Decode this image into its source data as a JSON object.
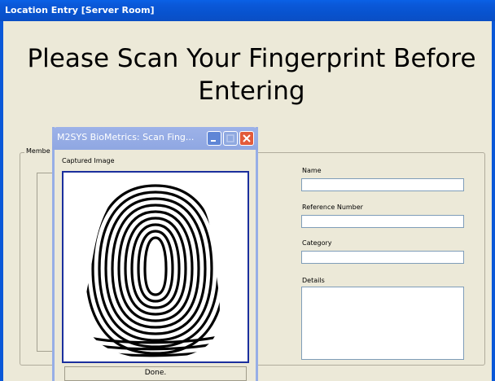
{
  "window": {
    "title": "Location Entry [Server Room]"
  },
  "heading": "Please Scan Your Fingerprint Before Entering",
  "member_group": {
    "legend": "Membe",
    "fields": [
      {
        "label": "Name",
        "value": ""
      },
      {
        "label": "Reference Number",
        "value": ""
      },
      {
        "label": "Category",
        "value": ""
      },
      {
        "label": "Details",
        "value": ""
      }
    ]
  },
  "dialog": {
    "title": "M2SYS BioMetrics: Scan Fing...",
    "captured_label": "Captured Image",
    "status": "Done.",
    "buttons": {
      "minimize": "minimize-icon",
      "maximize": "maximize-icon",
      "close": "close-icon"
    },
    "image_description": "fingerprint-image"
  },
  "colors": {
    "titlebar": "#0a58d8",
    "dialog_titlebar": "#97aee6",
    "close_button": "#e25a3a",
    "scan_border": "#1b2f9d",
    "window_bg": "#ece9d8"
  }
}
